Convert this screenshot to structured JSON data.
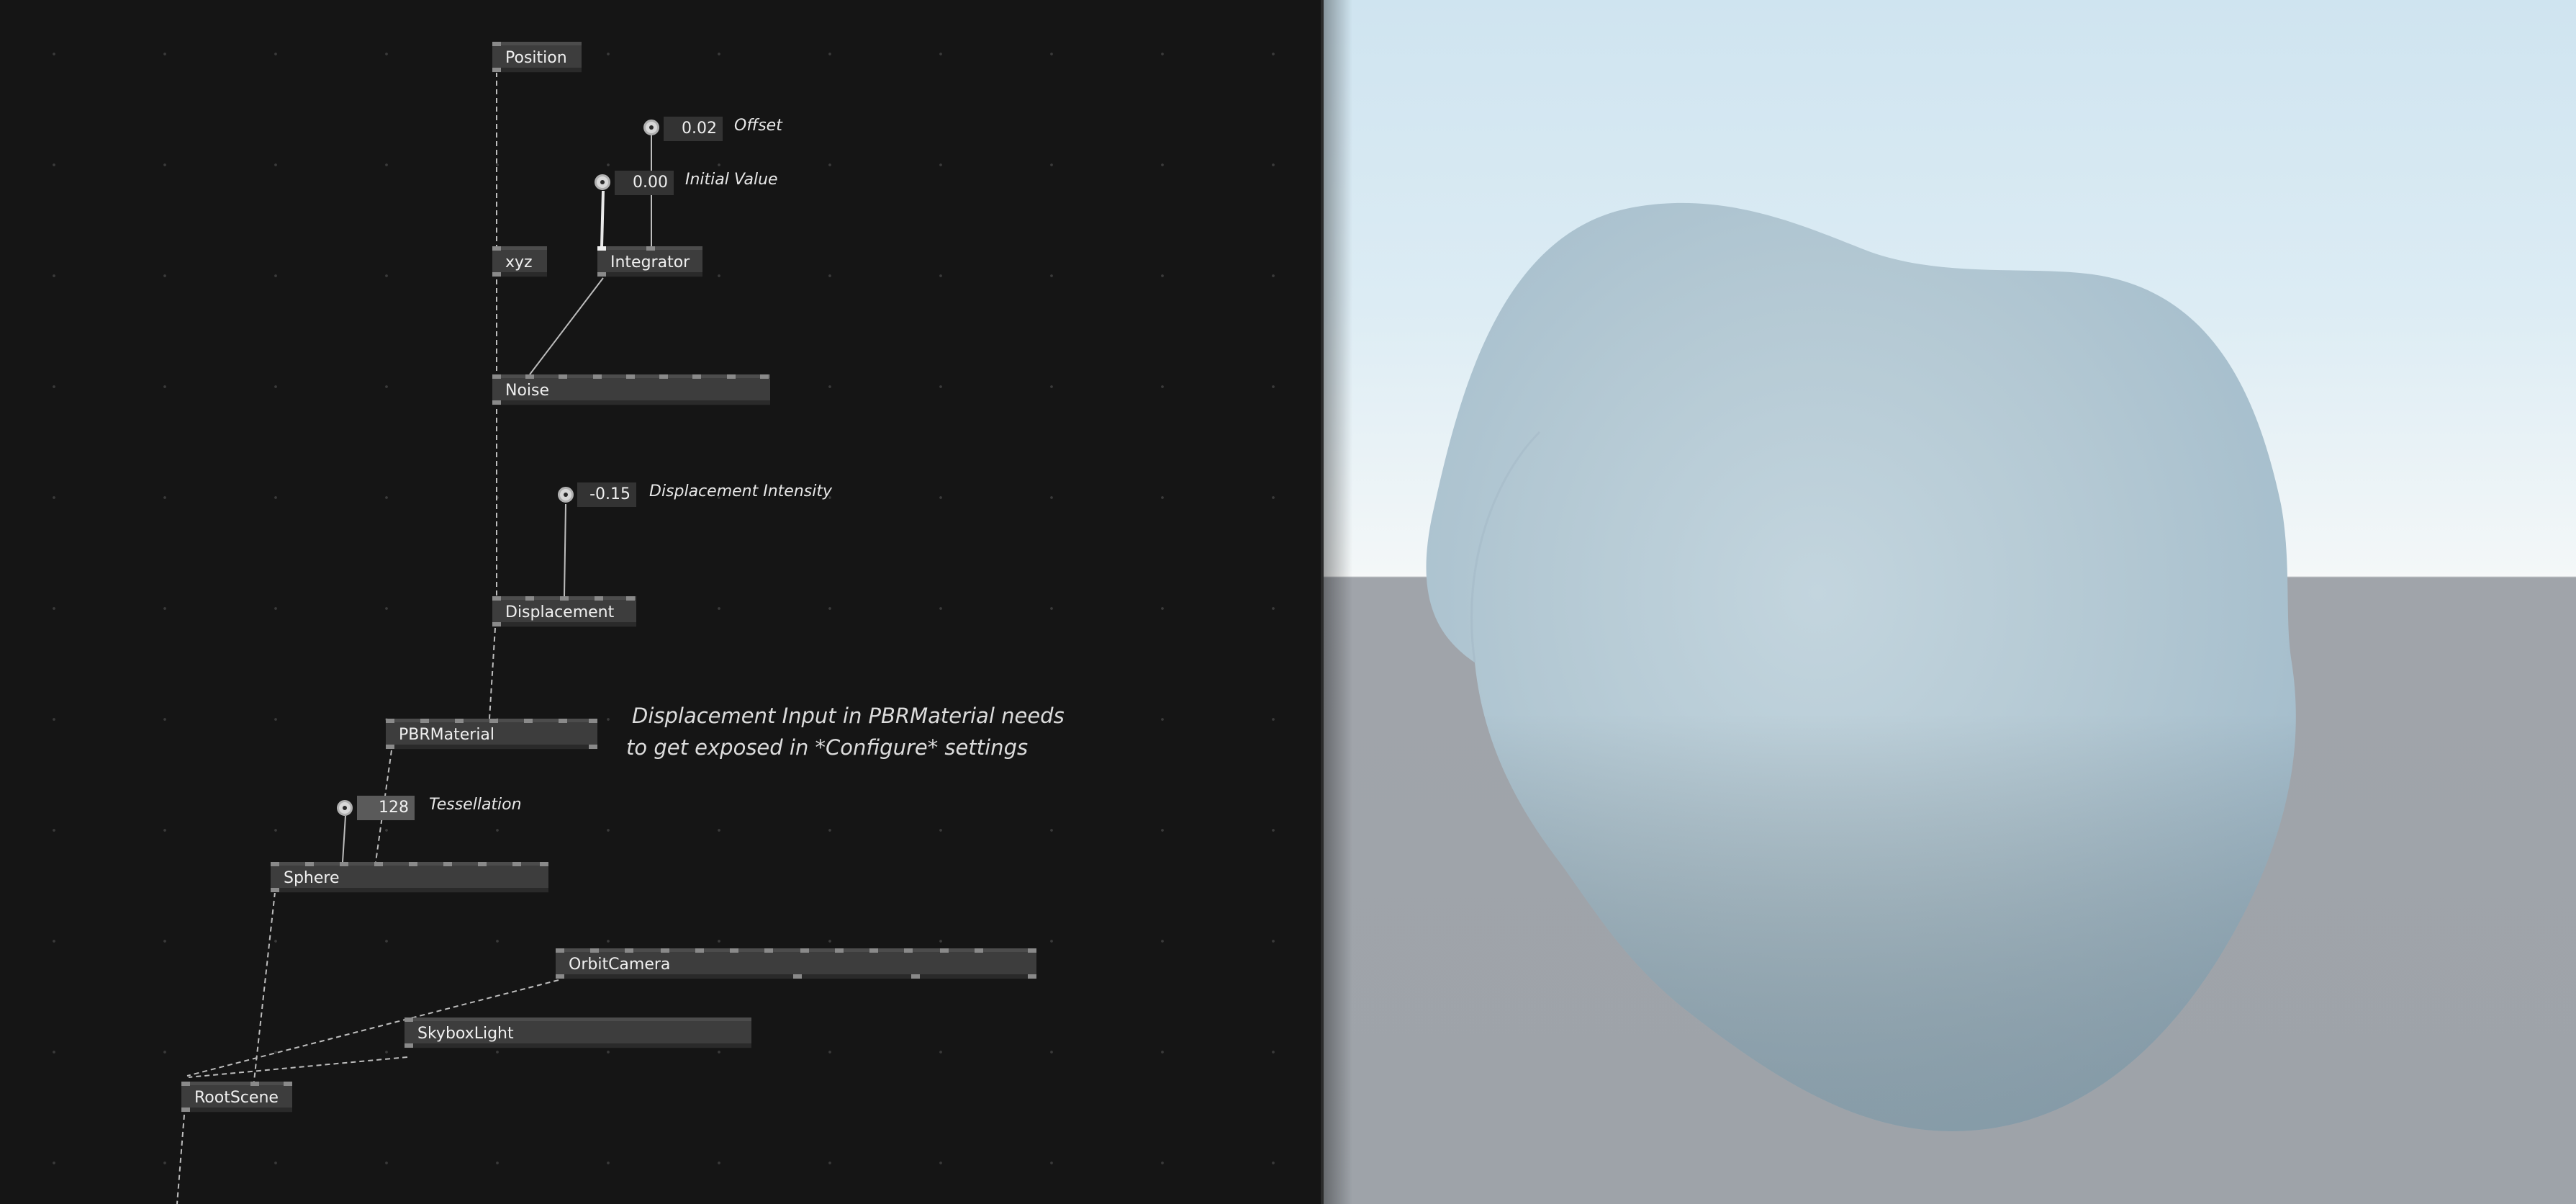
{
  "nodes": {
    "position": "Position",
    "xyz": "xyz",
    "integrator": "Integrator",
    "noise": "Noise",
    "displacement": "Displacement",
    "pbr_material": "PBRMaterial",
    "sphere": "Sphere",
    "orbit_camera": "OrbitCamera",
    "skybox_light": "SkyboxLight",
    "root_scene": "RootScene"
  },
  "io_boxes": {
    "offset": {
      "value": "0.02",
      "label": "Offset"
    },
    "initial_value": {
      "value": "0.00",
      "label": "Initial Value"
    },
    "displacement_intensity": {
      "value": "-0.15",
      "label": "Displacement Intensity"
    },
    "tessellation": {
      "value": "128",
      "label": "Tessellation"
    }
  },
  "comment": {
    "line1": "Displacement Input in PBRMaterial needs",
    "line2": "to get exposed in *Configure* settings"
  },
  "colors": {
    "editor_background": "#151515",
    "node_fill": "#3d3d3d",
    "sky_top": "#cfe4f0",
    "floor": "#9ea3a9",
    "blob": "#b5cbd6"
  }
}
